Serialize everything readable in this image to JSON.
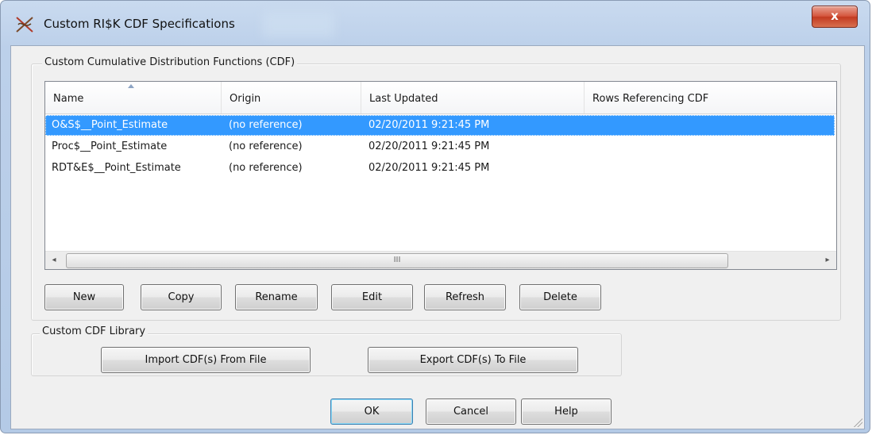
{
  "window": {
    "title": "Custom RI$K CDF Specifications",
    "close_label": "x"
  },
  "cdf_group": {
    "label": "Custom Cumulative Distribution Functions (CDF)"
  },
  "table": {
    "columns": [
      "Name",
      "Origin",
      "Last Updated",
      "Rows Referencing CDF"
    ],
    "sorted_column": "Name",
    "rows": [
      {
        "name": "O&S$__Point_Estimate",
        "origin": "(no reference)",
        "last_updated": "02/20/2011 9:21:45 PM",
        "rows_referencing": "",
        "selected": true
      },
      {
        "name": "Proc$__Point_Estimate",
        "origin": "(no reference)",
        "last_updated": "02/20/2011 9:21:45 PM",
        "rows_referencing": "",
        "selected": false
      },
      {
        "name": "RDT&E$__Point_Estimate",
        "origin": "(no reference)",
        "last_updated": "02/20/2011 9:21:45 PM",
        "rows_referencing": "",
        "selected": false
      }
    ],
    "scroll_left_glyph": "◂",
    "scroll_right_glyph": "▸",
    "scroll_thumb_grip": "III"
  },
  "buttons": {
    "new": "New",
    "copy": "Copy",
    "rename": "Rename",
    "edit": "Edit",
    "refresh": "Refresh",
    "delete": "Delete"
  },
  "library_group": {
    "label": "Custom CDF Library",
    "import_label": "Import CDF(s) From File",
    "export_label": "Export CDF(s) To File"
  },
  "footer": {
    "ok": "OK",
    "cancel": "Cancel",
    "help": "Help"
  },
  "colors": {
    "selection": "#3399ff",
    "close_button": "#c23a21",
    "title_bar": "#bcd0ea"
  }
}
